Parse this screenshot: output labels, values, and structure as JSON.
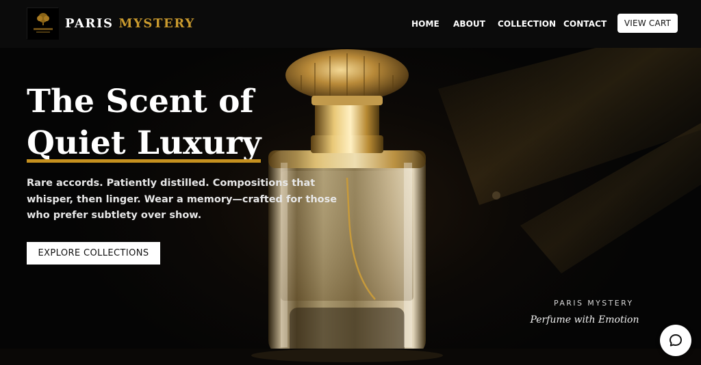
{
  "header": {
    "brand_word1": "PARIS",
    "brand_word2": "MYSTERY",
    "logo_caption": "PARIS MYSTERY",
    "logo_icon": "tree-emblem-icon",
    "nav": [
      "HOME",
      "ABOUT",
      "COLLECTION",
      "CONTACT"
    ],
    "cart_label": "VIEW CART"
  },
  "hero": {
    "headline_line1": "The Scent of",
    "headline_line2": "Quiet Luxury",
    "subtext": "Rare accords. Patiently distilled. Compositions that whisper, then linger. Wear a memory—crafted for those who prefer subtlety over show.",
    "cta_label": "EXPLORE COLLECTIONS",
    "tag_brand": "PARIS MYSTERY",
    "tag_line": "Perfume with Emotion",
    "chat_icon": "chat-bubble-icon"
  },
  "colors": {
    "accent_gold": "#c99a2e",
    "header_bg": "#0b0b0b",
    "hero_bg": "#050505"
  }
}
